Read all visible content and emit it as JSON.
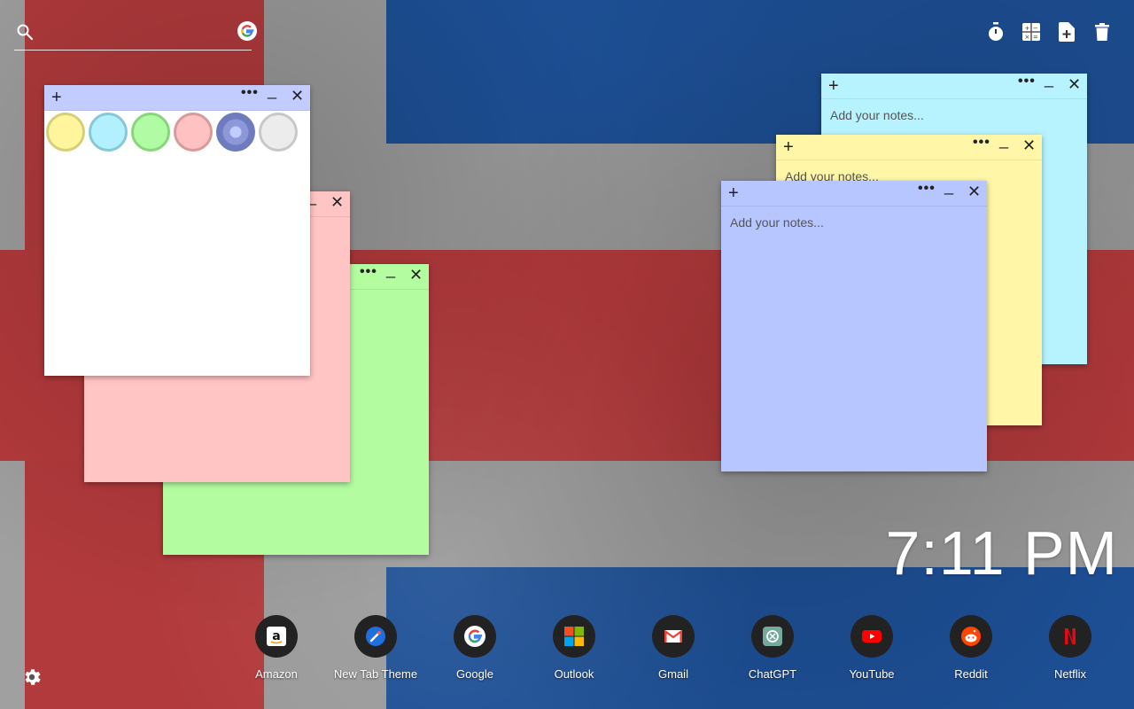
{
  "search": {
    "placeholder": "",
    "value": ""
  },
  "toolbar": {
    "icons": [
      "timer-icon",
      "calculator-icon",
      "add-note-icon",
      "trash-icon"
    ]
  },
  "notes": {
    "placeholder": "Add your notes...",
    "plus_label": "+",
    "menu_label": "•••",
    "minimize_label": "_",
    "close_label": "✕"
  },
  "palette": {
    "colors": [
      "#fff59d",
      "#b3f0ff",
      "#b2fba5",
      "#ffc1c1",
      "#8c98d8",
      "#ececec"
    ]
  },
  "note_colors": {
    "white": "#ffffff",
    "pink": "#ffc4c4",
    "green": "#b3fca0",
    "cyan": "#b7f3ff",
    "yellow": "#fff6a8",
    "blue": "#b8c6ff",
    "white_header": "#c2ccff",
    "blue_header": "#b8c6ff"
  },
  "clock": {
    "time": "7:11 PM"
  },
  "shortcuts": [
    {
      "label": "Amazon",
      "icon": "amazon-icon"
    },
    {
      "label": "New Tab Theme",
      "icon": "new-tab-theme-icon"
    },
    {
      "label": "Google",
      "icon": "google-icon"
    },
    {
      "label": "Outlook",
      "icon": "outlook-icon"
    },
    {
      "label": "Gmail",
      "icon": "gmail-icon"
    },
    {
      "label": "ChatGPT",
      "icon": "chatgpt-icon"
    },
    {
      "label": "YouTube",
      "icon": "youtube-icon"
    },
    {
      "label": "Reddit",
      "icon": "reddit-icon"
    },
    {
      "label": "Netflix",
      "icon": "netflix-icon"
    }
  ]
}
